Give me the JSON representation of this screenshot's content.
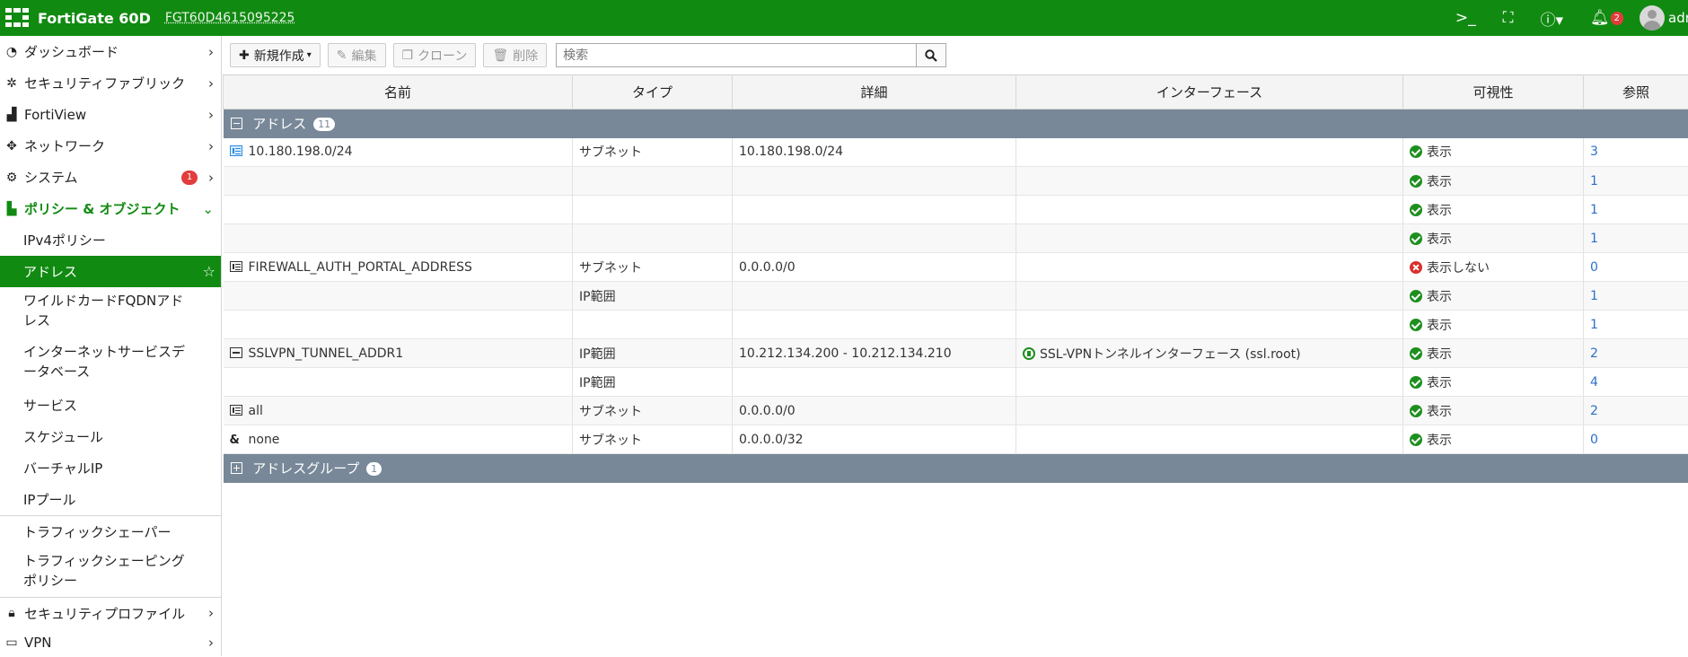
{
  "header": {
    "product": "FortiGate 60D",
    "hostname": "FGT60D4615095225",
    "notif_count": "2",
    "user": "admin",
    "icons": [
      "cli-console-icon",
      "fullscreen-icon",
      "help-icon",
      "bell-icon"
    ]
  },
  "sidebar": {
    "items": [
      {
        "label": "ダッシュボード",
        "icon": "dashboard-icon"
      },
      {
        "label": "セキュリティファブリック",
        "icon": "fabric-icon"
      },
      {
        "label": "FortiView",
        "icon": "chart-icon"
      },
      {
        "label": "ネットワーク",
        "icon": "network-icon"
      },
      {
        "label": "システム",
        "icon": "gear-icon",
        "badge": "1"
      },
      {
        "label": "ポリシー & オブジェクト",
        "icon": "policy-icon"
      }
    ],
    "sub_items": [
      {
        "label": "IPv4ポリシー"
      },
      {
        "label": "アドレス"
      },
      {
        "label": "ワイルドカードFQDNアドレス"
      },
      {
        "label": "インターネットサービスデータベース"
      },
      {
        "label": "サービス"
      },
      {
        "label": "スケジュール"
      },
      {
        "label": "バーチャルIP"
      },
      {
        "label": "IPプール"
      },
      {
        "label": "トラフィックシェーパー"
      },
      {
        "label": "トラフィックシェーピングポリシー"
      }
    ],
    "bottom_items": [
      {
        "label": "セキュリティプロファイル",
        "icon": "lock-icon"
      },
      {
        "label": "VPN",
        "icon": "laptop-icon"
      }
    ]
  },
  "toolbar": {
    "new_label": "新規作成",
    "edit_label": "編集",
    "clone_label": "クローン",
    "delete_label": "削除",
    "search_placeholder": "検索"
  },
  "table": {
    "columns": [
      "名前",
      "タイプ",
      "詳細",
      "インターフェース",
      "可視性",
      "参照"
    ],
    "group_address": {
      "label": "アドレス",
      "count": "11"
    },
    "group_addrgrp": {
      "label": "アドレスグループ",
      "count": "1"
    },
    "rows": [
      {
        "name": "10.180.198.0/24",
        "type": "サブネット",
        "detail": "10.180.198.0/24",
        "iface": "",
        "vis": "表示",
        "ref": "3"
      },
      {
        "name": "",
        "type": "",
        "detail": "",
        "iface": "",
        "vis": "表示",
        "ref": "1"
      },
      {
        "name": "",
        "type": "",
        "detail": "",
        "iface": "",
        "vis": "表示",
        "ref": "1"
      },
      {
        "name": "",
        "type": "",
        "detail": "",
        "iface": "",
        "vis": "表示",
        "ref": "1"
      },
      {
        "name": "FIREWALL_AUTH_PORTAL_ADDRESS",
        "type": "サブネット",
        "detail": "0.0.0.0/0",
        "iface": "",
        "vis": "表示しない",
        "ref": "0"
      },
      {
        "name": "",
        "type": "IP範囲",
        "detail": "",
        "iface": "",
        "vis": "表示",
        "ref": "1"
      },
      {
        "name": "",
        "type": "",
        "detail": "",
        "iface": "",
        "vis": "表示",
        "ref": "1"
      },
      {
        "name": "SSLVPN_TUNNEL_ADDR1",
        "type": "IP範囲",
        "detail": "10.212.134.200 - 10.212.134.210",
        "iface": "SSL-VPNトンネルインターフェース (ssl.root)",
        "vis": "表示",
        "ref": "2"
      },
      {
        "name": "",
        "type": "IP範囲",
        "detail": "",
        "iface": "",
        "vis": "表示",
        "ref": "4"
      },
      {
        "name": "all",
        "type": "サブネット",
        "detail": "0.0.0.0/0",
        "iface": "",
        "vis": "表示",
        "ref": "2"
      },
      {
        "name": "none",
        "type": "サブネット",
        "detail": "0.0.0.0/32",
        "iface": "",
        "vis": "表示",
        "ref": "0"
      }
    ]
  }
}
